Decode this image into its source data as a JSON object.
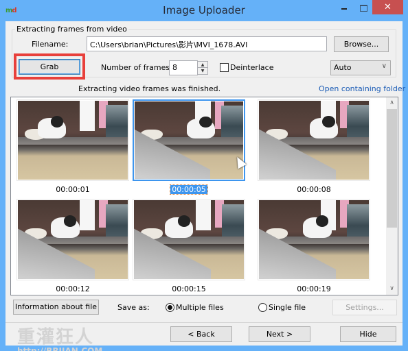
{
  "window": {
    "title": "Image Uploader",
    "app_icon": {
      "part1": "m",
      "part2": "d"
    },
    "controls": {
      "minimize": "minimize-icon",
      "maximize": "maximize-icon",
      "close": "✕"
    }
  },
  "extract_group": {
    "label": "Extracting frames from video",
    "filename_label": "Filename:",
    "filename_value": "C:\\Users\\brian\\Pictures\\影片\\MVI_1678.AVI",
    "browse_label": "Browse...",
    "grab_label": "Grab",
    "frames_label": "Number of frames:",
    "frames_value": "8",
    "spin_up": "▲",
    "spin_down": "▼",
    "deinterlace_label": "Deinterlace",
    "deinterlace_checked": false,
    "mode_value": "Auto",
    "mode_arrow": "∨"
  },
  "status": {
    "message": "Extracting video frames was finished.",
    "open_folder_link": "Open containing folder"
  },
  "frames": [
    {
      "time": "00:00:01",
      "selected": false
    },
    {
      "time": "00:00:05",
      "selected": true
    },
    {
      "time": "00:00:08",
      "selected": false
    },
    {
      "time": "00:00:12",
      "selected": false
    },
    {
      "time": "00:00:15",
      "selected": false
    },
    {
      "time": "00:00:19",
      "selected": false
    }
  ],
  "scrollbar": {
    "up": "∧",
    "down": "∨",
    "position_fraction": 0.0,
    "visible_fraction": 0.68
  },
  "bottom": {
    "info_button": "Information about file",
    "save_as_label": "Save as:",
    "multiple_files": "Multiple files",
    "single_file": "Single file",
    "save_mode": "multiple",
    "settings_button": "Settings..."
  },
  "nav": {
    "back": "< Back",
    "next": "Next >",
    "hide": "Hide"
  },
  "watermark": {
    "line1": "重灌狂人",
    "line2": "http://BRIIAN.COM"
  }
}
